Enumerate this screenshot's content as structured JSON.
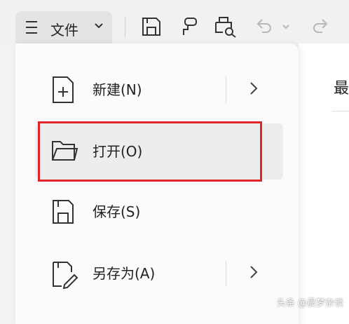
{
  "toolbar": {
    "file_label": "文件",
    "icons": [
      "hamburger-icon",
      "chevron-down-icon",
      "save-icon",
      "format-painter-icon",
      "print-preview-icon",
      "undo-icon",
      "redo-icon"
    ]
  },
  "menu": {
    "items": [
      {
        "label": "新建(N)",
        "icon": "new-file-icon",
        "has_submenu": true
      },
      {
        "label": "打开(O)",
        "icon": "folder-icon",
        "has_submenu": false,
        "selected": true
      },
      {
        "label": "保存(S)",
        "icon": "save-icon",
        "has_submenu": false
      },
      {
        "label": "另存为(A)",
        "icon": "save-as-icon",
        "has_submenu": true
      }
    ]
  },
  "right_panel": {
    "title": "最"
  },
  "highlight": {
    "color": "#e0262a"
  },
  "watermark": "头条 @晨梦杂谈"
}
